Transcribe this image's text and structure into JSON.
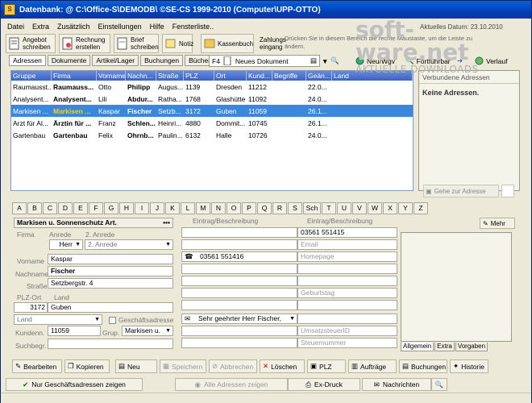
{
  "window": {
    "title": "Datenbank: @ C:\\Office-S\\DEMODB\\ ©SE-CS 1999-2010 (Computer\\UPP-OTTO)"
  },
  "watermark": {
    "main": "soft-ware.net",
    "sub": "AKTUELLE DOWNLOADS",
    "date_text": "Aktuelles Datum: 23.10.2010"
  },
  "menu": [
    "Datei",
    "Extra",
    "Zusätzlich",
    "Einstellungen",
    "Hilfe",
    "Fensterliste.."
  ],
  "toolbar": {
    "angebot": "Angebot schreiben",
    "rechnung": "Rechnung erstellen",
    "brief": "Brief schreiben",
    "notiz": "Notiz",
    "kassenbuch": "Kassenbuch",
    "zahlungseingang": "Zahlungs-eingang",
    "hint": "Drücken Sie in diesem Bereich die rechte Maustaste, um die Leiste zu ändern."
  },
  "tabs": [
    "Adressen",
    "Dokumente",
    "Artikel/Lager",
    "Buchungen",
    "Bücher"
  ],
  "doc_select": {
    "prefix": "F4",
    "value": "Neues Dokument"
  },
  "small_toolbar": {
    "neu_wgv": "Neu/Wgv",
    "fortfuehrbar": "Fortführbar",
    "verlauf": "Verlauf"
  },
  "grid": {
    "columns": [
      "Gruppe",
      "Firma",
      "Vorname",
      "Nachn...",
      "Straße",
      "PLZ",
      "Ort",
      "Kund...",
      "Begriffe",
      "Geän...",
      "Land"
    ],
    "rows": [
      [
        "Raumausst...",
        "Raumauss...",
        "Otto",
        "Philipp",
        "Augus...",
        "1139",
        "Dresden",
        "11212",
        "",
        "22.0...",
        ""
      ],
      [
        "Analysent...",
        "Analysent...",
        "Lili",
        "Abdur...",
        "Ratha...",
        "1768",
        "Glashütte",
        "11092",
        "",
        "24.0...",
        ""
      ],
      [
        "Markisen ...",
        "Markisen ...",
        "Kaspar",
        "Fischer",
        "Setzb...",
        "3172",
        "Guben",
        "11059",
        "",
        "26.1...",
        ""
      ],
      [
        "Arzt für Al...",
        "Ärztin für ...",
        "Franz",
        "Schlen...",
        "Heinri...",
        "4880",
        "Dommit...",
        "10745",
        "",
        "26.1...",
        ""
      ],
      [
        "Gartenbau",
        "Gartenbau",
        "Felix",
        "Ohrnb...",
        "Paulin...",
        "6132",
        "Halle",
        "10726",
        "",
        "24.0...",
        ""
      ]
    ],
    "selected_row": 2
  },
  "related": {
    "header": "Verbundene Adressen",
    "empty": "Keine Adressen.",
    "goto_button": "Gehe zur Adresse"
  },
  "letters": [
    "A",
    "B",
    "C",
    "D",
    "E",
    "F",
    "G",
    "H",
    "I",
    "J",
    "K",
    "L",
    "M",
    "N",
    "O",
    "P",
    "Q",
    "R",
    "S",
    "Sch",
    "T",
    "U",
    "V",
    "W",
    "X",
    "Y",
    "Z"
  ],
  "form": {
    "group_name": "Markisen u. Sonnenschutz Art.",
    "firma_label": "Firma",
    "anrede_label": "Anrede",
    "anrede2_label": "2. Anrede",
    "anrede_value": "Herr",
    "anrede2_value": "2. Anrede",
    "vorname_label": "Vorname",
    "vorname": "Kaspar",
    "nachname_label": "Nachname",
    "nachname": "Fischer",
    "strasse_label": "Straße",
    "strasse": "Setzbergstr. 4",
    "plz_ort_label": "PLZ-Ort",
    "land_label": "Land",
    "plz": "3172",
    "ort": "Guben",
    "land_value": "Land",
    "geschaeftsadresse": "Geschäftsadresse",
    "kundennr_label": "Kundenn.",
    "kundennr": "11059",
    "gruppe_label": "Grup.",
    "gruppe_value": "Markisen u.",
    "suchbegr_label": "Suchbegr.",
    "eintrag_label_1": "Eintrag/Beschreibung",
    "eintrag_label_2": "Eintrag/Beschreibung",
    "phone1": "03561 551416",
    "phone2": "03561 551415",
    "email_label": "Email",
    "homepage_label": "Homepage",
    "geburtstag_label": "Geburtstag",
    "briefanrede": "Sehr geehrter Herr Fischer,",
    "ust_label": "UmsatzsteuerID",
    "steuernummer_label": "Steuernummer",
    "mehr": "Mehr",
    "right_tabs": [
      "Allgemein",
      "Extra",
      "Vorgaben"
    ]
  },
  "bottom_buttons": {
    "bearbeiten": "Bearbeiten",
    "kopieren": "Kopieren",
    "neu": "Neu",
    "speichern": "Speichern",
    "abbrechen": "Abbrechen",
    "loeschen": "Löschen",
    "plz": "PLZ",
    "auftraege": "Aufträge",
    "buchungen": "Buchungen",
    "historie": "Historie"
  },
  "bottom_bar": {
    "nur_geschaeft": "Nur Geschäftsadressen zeigen",
    "alle_adressen": "Alle Adressen zeigen",
    "ex_druck": "Ex-Druck",
    "nachrichten": "Nachrichten"
  },
  "colors": {
    "titlebar": "#0a5fd8",
    "selection": "#3a87dc",
    "grid_header": "#3a63c8",
    "window_bg": "#ece9d8"
  }
}
